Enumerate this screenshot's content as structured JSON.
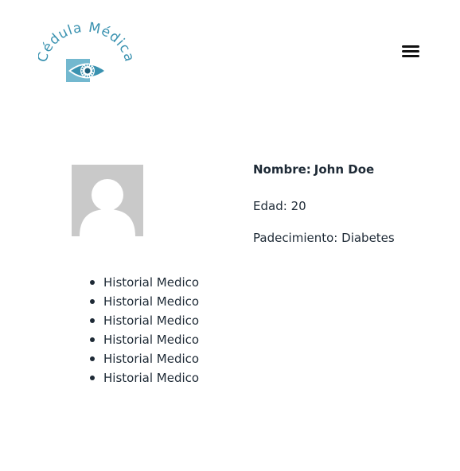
{
  "header": {
    "logo_text": "Cédula Médica",
    "menu_icon": "hamburger-menu-icon"
  },
  "colors": {
    "logo_teal": "#3a92b0",
    "logo_light": "#73b8cf",
    "text": "#1e2a36",
    "avatar_bg": "#c9c9c9"
  },
  "patient": {
    "avatar_icon": "user-placeholder-icon",
    "name_label": "Nombre:",
    "name": "John Doe",
    "age_label": "Edad:",
    "age": "20",
    "condition_label": "Padecimiento:",
    "condition": "Diabetes"
  },
  "history": [
    "Historial Medico",
    "Historial Medico",
    "Historial Medico",
    "Historial Medico",
    "Historial Medico",
    "Historial Medico"
  ]
}
